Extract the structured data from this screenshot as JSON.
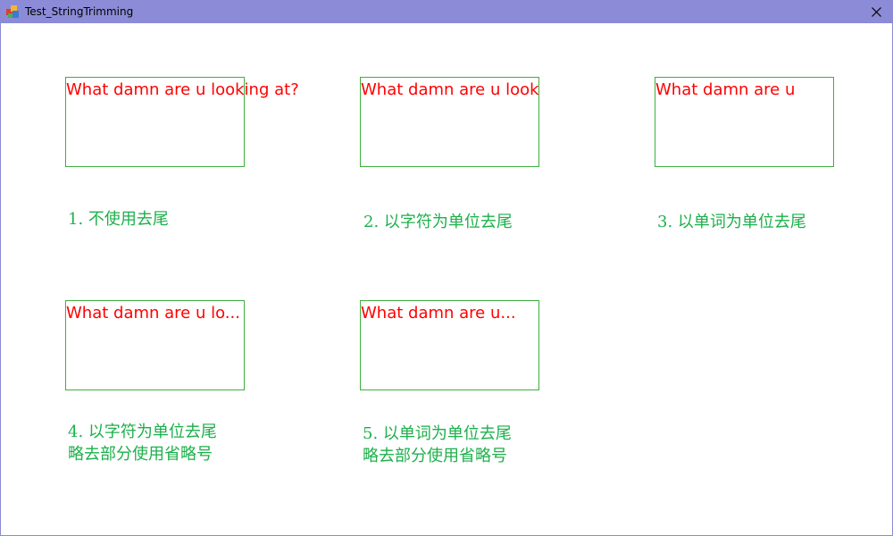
{
  "window": {
    "title": "Test_StringTrimming",
    "icon": "app-icon",
    "close_icon": "close-icon"
  },
  "samples": [
    {
      "text": "What damn are u looking at?",
      "caption": "1. 不使用去尾"
    },
    {
      "text": "What damn are u look",
      "caption": "2. 以字符为单位去尾"
    },
    {
      "text": "What damn are u",
      "caption": "3. 以单词为单位去尾"
    },
    {
      "text": "What damn are u lo...",
      "caption_line1": "4. 以字符为单位去尾",
      "caption_line2": "略去部分使用省略号"
    },
    {
      "text": "What damn are u...",
      "caption_line1": "5. 以单词为单位去尾",
      "caption_line2": "略去部分使用省略号"
    }
  ],
  "colors": {
    "sample_text": "#ff0000",
    "box_border": "#3fae3f",
    "caption": "#1db04b",
    "titlebar": "#8b8bd8"
  }
}
